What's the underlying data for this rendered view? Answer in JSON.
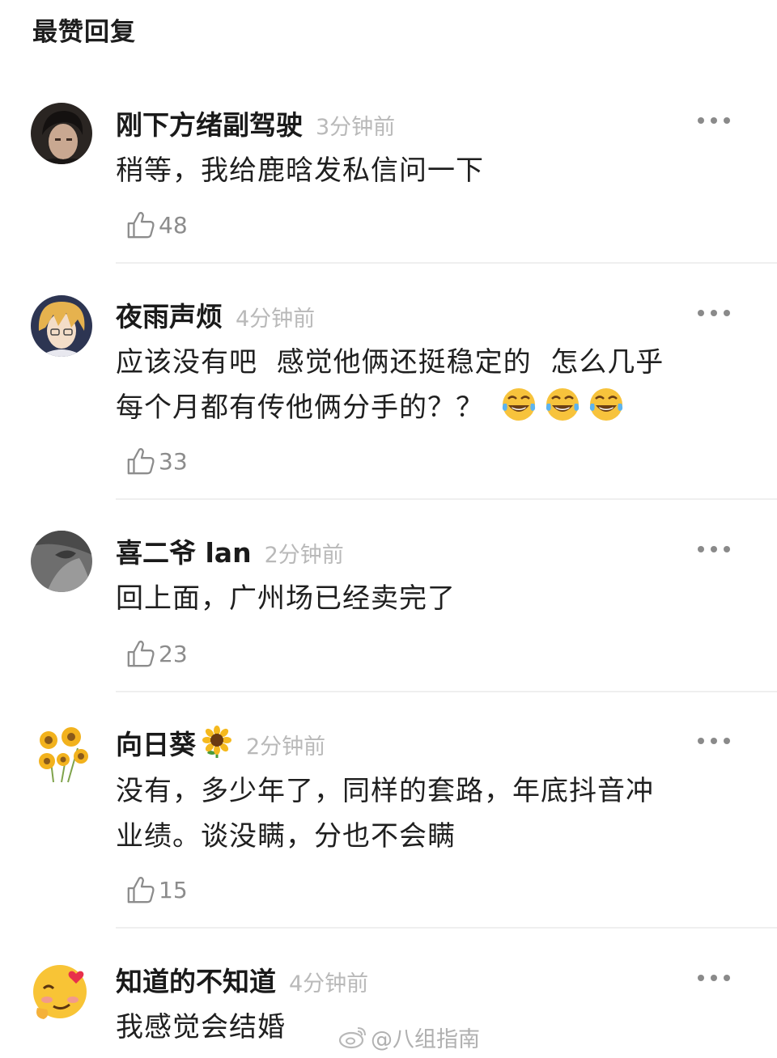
{
  "section_title": "最赞回复",
  "comments": [
    {
      "username": "刚下方绪副驾驶",
      "time": "3分钟前",
      "lines": [
        "稍等，我给鹿晗发私信问一下"
      ],
      "likes": "48",
      "avatar": "portrait-dark-hair"
    },
    {
      "username": "夜雨声烦",
      "time": "4分钟前",
      "lines": [
        "应该没有吧  感觉他俩还挺稳定的  怎么几乎",
        "每个月都有传他俩分手的？？"
      ],
      "trailing_emoji": [
        "tears-of-joy-emoji",
        "tears-of-joy-emoji",
        "tears-of-joy-emoji"
      ],
      "likes": "33",
      "avatar": "anime-character-blond"
    },
    {
      "username": "喜二爷 lan",
      "time": "2分钟前",
      "lines": [
        "回上面，广州场已经卖完了"
      ],
      "likes": "23",
      "avatar": "grey-abstract"
    },
    {
      "username": "向日葵",
      "username_emoji": "sunflower-emoji",
      "time": "2分钟前",
      "lines": [
        "没有，多少年了，同样的套路，年底抖音冲",
        "业绩。谈没瞒，分也不会瞒"
      ],
      "likes": "15",
      "avatar": "sunflowers"
    },
    {
      "username": "知道的不知道",
      "time": "4分钟前",
      "lines": [
        "我感觉会结婚"
      ],
      "avatar": "blushing-heart-face-emoji"
    }
  ],
  "watermark": "@八组指南",
  "colors": {
    "time": "#b9b9b9",
    "count": "#8c8c8c",
    "divider": "#efefef",
    "text": "#1f1f1f"
  }
}
